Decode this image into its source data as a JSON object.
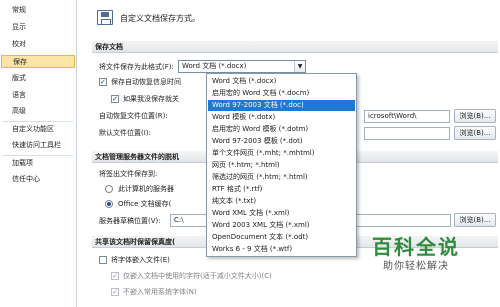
{
  "sidebar": {
    "items": [
      {
        "label": "常规"
      },
      {
        "label": "显示"
      },
      {
        "label": "校对"
      },
      {
        "label": "保存",
        "active": true
      },
      {
        "label": "版式"
      },
      {
        "label": "语言"
      },
      {
        "label": "高级"
      },
      {
        "label": "自定义功能区"
      },
      {
        "label": "快速访问工具栏"
      },
      {
        "label": "加载项"
      },
      {
        "label": "信任中心"
      }
    ]
  },
  "header": {
    "title": "自定义文档保存方式。",
    "icon": "save-doc-icon"
  },
  "save_docs": {
    "section_title": "保存文档",
    "format_label": "将文件保存为此格式(F):",
    "format_value": "Word 文档 (*.docx)",
    "autorecover_label": "保存自动恢复信息时间",
    "autorecover_checked": true,
    "keep_last_label": "如果我没保存就关",
    "keep_last_checked": true,
    "autorecover_location_label": "自动恢复文件位置(R):",
    "autorecover_location_value": "icrosoft\\Word\\",
    "default_location_label": "默认文件位置(I):",
    "browse_label": "浏览(B)..."
  },
  "server_files": {
    "section_title": "文档管理服务器文件的脱机",
    "checkout_label": "将签出文件保存到:",
    "option_server_label": "此计算机的服务器",
    "option_office_label": "Office 文档缓存(",
    "drafts_label": "服务器草稿位置(V):",
    "drafts_value": "C:\\",
    "browse_label": "浏览(B)..."
  },
  "share_section": {
    "section_title": "共享该文档时保留保真度(",
    "embed_fonts_label": "将字体嵌入文件(E)",
    "embed_subset_label": "仅嵌入文档中使用的字符(适于减小文件大小)(C)",
    "no_common_fonts_label": "不嵌入常用系统字体(N)"
  },
  "dropdown": {
    "selected_index": 2,
    "options": [
      "Word 文档 (*.docx)",
      "启用宏的 Word 文档 (*.docm)",
      "Word 97-2003 文档 (*.doc)",
      "Word 模板 (*.dotx)",
      "启用宏的 Word 模板 (*.dotm)",
      "Word 97-2003 模板 (*.dot)",
      "单个文件网页 (*.mht; *.mhtml)",
      "网页 (*.htm; *.html)",
      "筛选过的网页 (*.htm; *.html)",
      "RTF 格式 (*.rtf)",
      "纯文本 (*.txt)",
      "Word XML 文档 (*.xml)",
      "Word 2003 XML 文档 (*.xml)",
      "OpenDocument 文本 (*.odt)",
      "Works 6 - 9 文档 (*.wtf)"
    ]
  },
  "watermark": {
    "main": "百科全说",
    "sub": "助你轻松解决"
  },
  "colors": {
    "active_nav": "#fce3a6",
    "selection": "#1e78d4",
    "watermark": "#2e8c3c"
  }
}
